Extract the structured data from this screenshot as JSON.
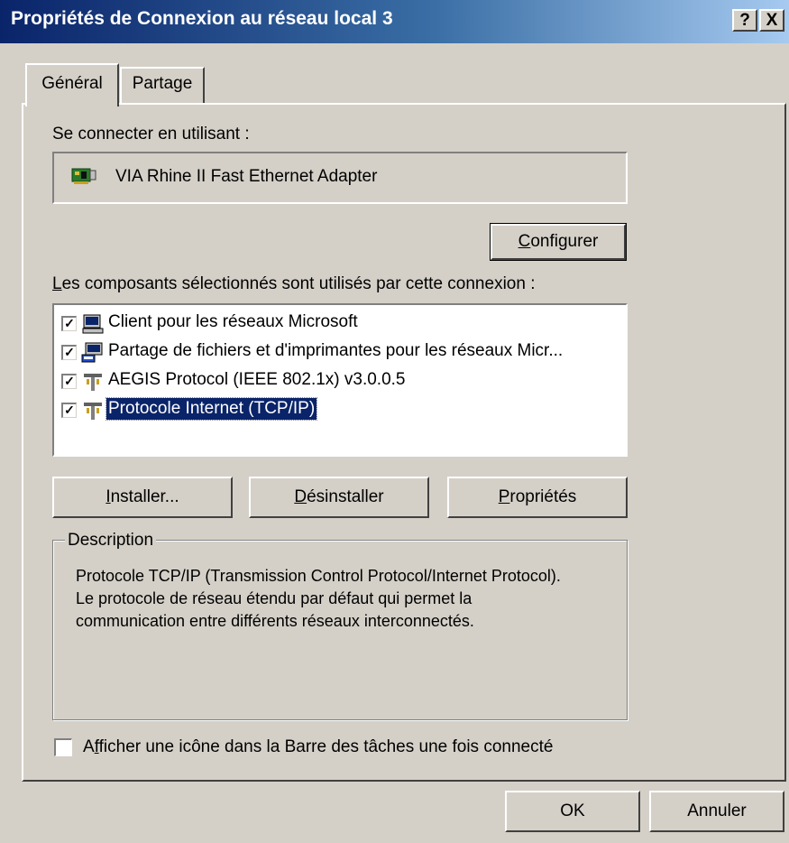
{
  "window": {
    "title": "Propriétés de Connexion au réseau local 3",
    "help_button": "?",
    "close_button": "X"
  },
  "tabs": [
    {
      "label": "Général",
      "active": true
    },
    {
      "label": "Partage",
      "active": false
    }
  ],
  "connect_using": {
    "label": "Se connecter en utilisant :",
    "adapter": "VIA Rhine II Fast Ethernet Adapter",
    "adapter_icon": "network-adapter-icon"
  },
  "configure_button": {
    "first": "C",
    "rest": "onfigurer"
  },
  "components": {
    "label_first": "L",
    "label_rest": "es composants sélectionnés sont utilisés par cette connexion :",
    "items": [
      {
        "label": "Client pour les réseaux Microsoft",
        "checked": true,
        "icon": "client-computer-icon",
        "selected": false
      },
      {
        "label": "Partage de fichiers et d'imprimantes pour les réseaux Micr...",
        "checked": true,
        "icon": "file-printer-sharing-icon",
        "selected": false
      },
      {
        "label": "AEGIS Protocol (IEEE 802.1x) v3.0.0.5",
        "checked": true,
        "icon": "protocol-icon",
        "selected": false
      },
      {
        "label": "Protocole Internet (TCP/IP)",
        "checked": true,
        "icon": "protocol-icon",
        "selected": true
      }
    ]
  },
  "buttons": {
    "install": {
      "first": "I",
      "rest": "nstaller..."
    },
    "uninstall": {
      "first": "D",
      "rest": "ésinstaller"
    },
    "properties": {
      "first": "P",
      "rest": "ropriétés"
    }
  },
  "description": {
    "title": "Description",
    "text": "Protocole TCP/IP (Transmission Control Protocol/Internet Protocol). Le protocole de réseau étendu par défaut qui permet la communication entre différents réseaux interconnectés."
  },
  "show_icon": {
    "checked": false,
    "label_pre": "A",
    "label_ul": "f",
    "label_rest": "ficher une icône dans la Barre des tâches une fois connecté"
  },
  "dialog_buttons": {
    "ok": "OK",
    "cancel": "Annuler"
  },
  "colors": {
    "title_start": "#0a246a",
    "title_end": "#a6caf0",
    "selection": "#0a246a",
    "face": "#d4d0c8"
  }
}
